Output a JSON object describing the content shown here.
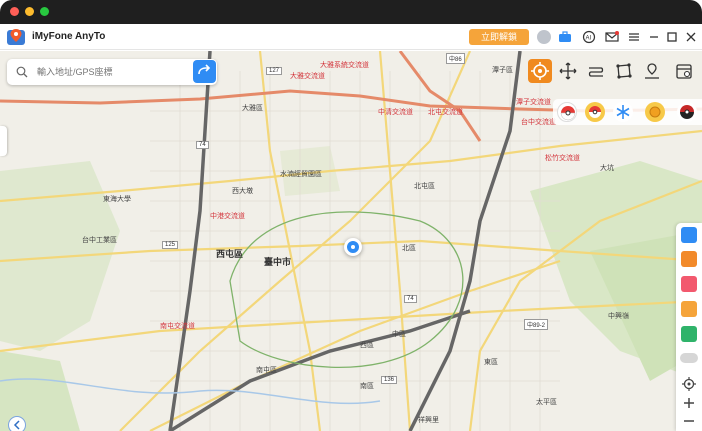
{
  "app": {
    "title": "iMyFone AnyTo",
    "unlock_label": "立即解鎖"
  },
  "search": {
    "placeholder": "輸入地址/GPS座標"
  },
  "colors": {
    "accent": "#f08a1f",
    "primary": "#2f8cf4",
    "unlock": "#f5a43a"
  },
  "mode_toolbar": [
    {
      "name": "teleport-mode-icon",
      "active": true
    },
    {
      "name": "joystick-mode-icon",
      "active": false
    },
    {
      "name": "two-spot-mode-icon",
      "active": false
    },
    {
      "name": "multi-spot-mode-icon",
      "active": false
    },
    {
      "name": "jump-teleport-icon",
      "active": false
    },
    {
      "name": "history-icon",
      "active": false
    }
  ],
  "map": {
    "labels": [
      {
        "text": "大雅交流道",
        "cls": "red"
      },
      {
        "text": "大雅系統交流道",
        "cls": "red"
      },
      {
        "text": "中清交流道",
        "cls": "red"
      },
      {
        "text": "北屯交流道",
        "cls": "red"
      },
      {
        "text": "松竹交流道",
        "cls": "red"
      },
      {
        "text": "潭子區",
        "cls": ""
      },
      {
        "text": "潭子交流道",
        "cls": "red"
      },
      {
        "text": "台中交流道",
        "cls": "red"
      },
      {
        "text": "大雅區",
        "cls": ""
      },
      {
        "text": "西屯區",
        "cls": "big"
      },
      {
        "text": "北屯區",
        "cls": ""
      },
      {
        "text": "北區",
        "cls": ""
      },
      {
        "text": "臺中市",
        "cls": "big"
      },
      {
        "text": "中區",
        "cls": ""
      },
      {
        "text": "西區",
        "cls": ""
      },
      {
        "text": "南屯區",
        "cls": ""
      },
      {
        "text": "東區",
        "cls": ""
      },
      {
        "text": "南區",
        "cls": ""
      },
      {
        "text": "太平區",
        "cls": ""
      },
      {
        "text": "水湳經貿園區",
        "cls": ""
      },
      {
        "text": "台中工業區",
        "cls": ""
      },
      {
        "text": "東海大學",
        "cls": ""
      },
      {
        "text": "西大墩",
        "cls": ""
      },
      {
        "text": "中港交流道",
        "cls": "red"
      },
      {
        "text": "南屯交流道",
        "cls": "red"
      },
      {
        "text": "祥興里",
        "cls": ""
      },
      {
        "text": "中興嶺",
        "cls": ""
      },
      {
        "text": "大坑",
        "cls": ""
      }
    ],
    "shields": [
      "127",
      "136",
      "125",
      "74",
      "74",
      "中89-2",
      "中86"
    ]
  },
  "side_panel": [
    {
      "name": "device-icon"
    },
    {
      "name": "gift-icon"
    },
    {
      "name": "shirt-icon"
    },
    {
      "name": "folder-plus-icon"
    },
    {
      "name": "send-icon"
    },
    {
      "name": "toggle-icon"
    },
    {
      "name": "locate-icon"
    },
    {
      "name": "zoom-in-icon"
    },
    {
      "name": "zoom-out-icon"
    }
  ]
}
